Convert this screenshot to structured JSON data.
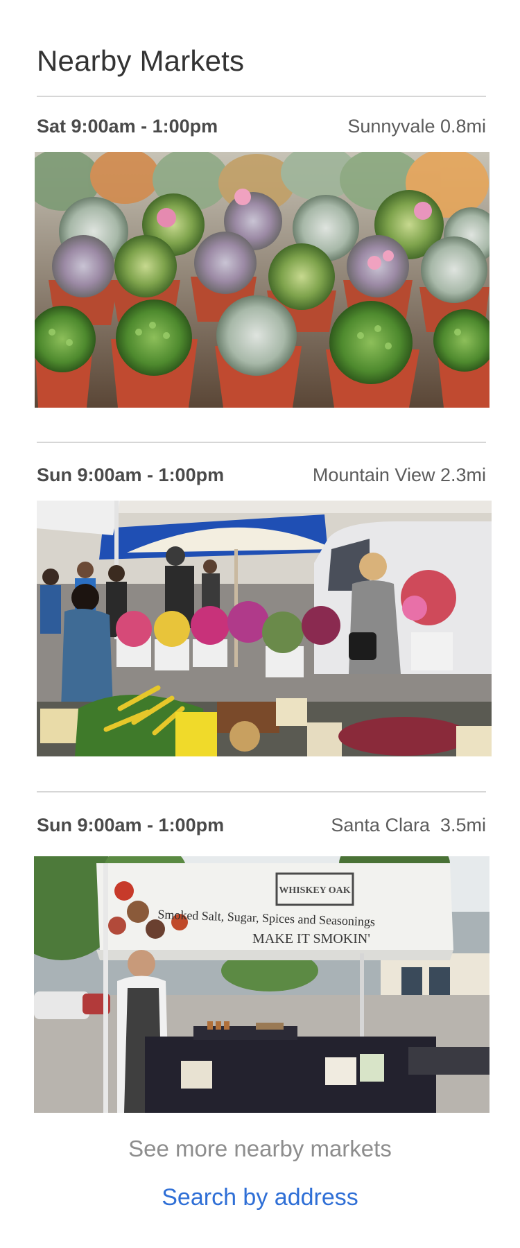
{
  "page": {
    "title": "Nearby Markets"
  },
  "markets": [
    {
      "schedule": "Sat 9:00am - 1:00pm",
      "location": "Sunnyvale 0.8mi",
      "photo": "succulents-photo"
    },
    {
      "schedule": "Sun 9:00am - 1:00pm",
      "location": "Mountain View 2.3mi",
      "photo": "produce-stand-photo"
    },
    {
      "schedule": "Sun 9:00am - 1:00pm",
      "location": "Santa Clara  3.5mi",
      "photo": "vendor-booth-photo",
      "banner": {
        "brand_line1": "WHISKEY OAK",
        "headline": "Smoked Salt, Sugar, Spices and Seasonings",
        "tagline": "MAKE IT SMOKIN'"
      }
    }
  ],
  "footer": {
    "see_more": "See more nearby markets",
    "search_link": "Search by address"
  },
  "colors": {
    "link": "#2f6fd6",
    "muted": "#8d8d8d",
    "divider": "#d6d6d6"
  }
}
